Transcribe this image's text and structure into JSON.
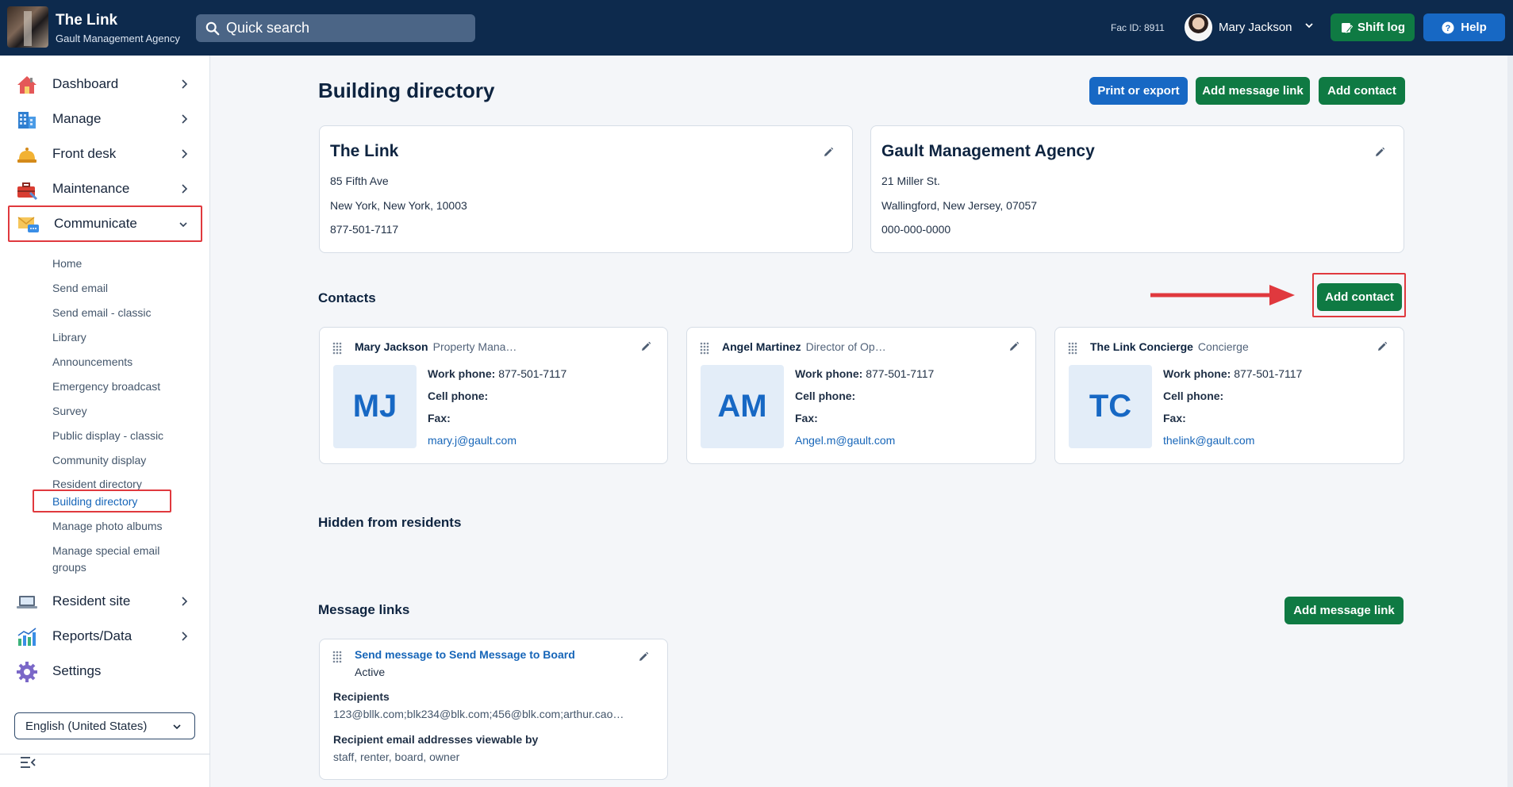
{
  "topbar": {
    "app_title": "The Link",
    "app_subtitle": "Gault Management Agency",
    "search_placeholder": "Quick search",
    "fac_id": "Fac ID: 8911",
    "user_name": "Mary Jackson",
    "shift_log_label": "Shift log",
    "help_label": "Help"
  },
  "sidebar": {
    "items": [
      {
        "label": "Dashboard",
        "icon": "house-icon"
      },
      {
        "label": "Manage",
        "icon": "building-icon"
      },
      {
        "label": "Front desk",
        "icon": "bell-icon"
      },
      {
        "label": "Maintenance",
        "icon": "toolbox-icon"
      },
      {
        "label": "Communicate",
        "icon": "envelope-chat-icon",
        "expanded": true
      },
      {
        "label": "Resident site",
        "icon": "laptop-icon"
      },
      {
        "label": "Reports/Data",
        "icon": "chart-icon"
      },
      {
        "label": "Settings",
        "icon": "gear-icon"
      }
    ],
    "sub_items": [
      "Home",
      "Send email",
      "Send email - classic",
      "Library",
      "Announcements",
      "Emergency broadcast",
      "Survey",
      "Public display - classic",
      "Community display",
      "Resident directory",
      "Building directory",
      "Manage photo albums",
      "Manage special email",
      "groups"
    ],
    "active_sub_item": "Building directory",
    "language": "English (United States)"
  },
  "main": {
    "page_title": "Building directory",
    "header_buttons": {
      "print_export": "Print or export",
      "add_message_link": "Add message link",
      "add_contact": "Add contact"
    },
    "buildings": [
      {
        "name": "The Link",
        "address1": "85 Fifth Ave",
        "address2": "New York, New York, 10003",
        "phone": "877-501-7117"
      },
      {
        "name": "Gault Management Agency",
        "address1": "21 Miller St.",
        "address2": "Wallingford, New Jersey, 07057",
        "phone": "000-000-0000"
      }
    ],
    "contacts_title": "Contacts",
    "contacts_add_button": "Add contact",
    "contact_labels": {
      "work": "Work phone:",
      "cell": "Cell phone:",
      "fax": "Fax:"
    },
    "contacts": [
      {
        "name": "Mary Jackson",
        "role": "Property Mana…",
        "initials": "MJ",
        "work_phone": "877-501-7117",
        "email": "mary.j@gault.com"
      },
      {
        "name": "Angel Martinez",
        "role": "Director of Op…",
        "initials": "AM",
        "work_phone": "877-501-7117",
        "email": "Angel.m@gault.com"
      },
      {
        "name": "The Link Concierge",
        "role": "Concierge",
        "initials": "TC",
        "work_phone": "877-501-7117",
        "email": "thelink@gault.com"
      }
    ],
    "hidden_title": "Hidden from residents",
    "message_links_title": "Message links",
    "message_links_add_button": "Add message link",
    "message_link": {
      "title": "Send message to Send Message to Board",
      "status": "Active",
      "recipients_label": "Recipients",
      "recipients": "123@bllk.com;blk234@blk.com;456@blk.com;arthur.cao…",
      "viewable_label": "Recipient email addresses viewable by",
      "viewable": "staff, renter, board, owner"
    }
  },
  "colors": {
    "navy": "#0d2a4d",
    "green": "#0f7a43",
    "blue": "#1768c4",
    "highlight": "#e0393e"
  }
}
